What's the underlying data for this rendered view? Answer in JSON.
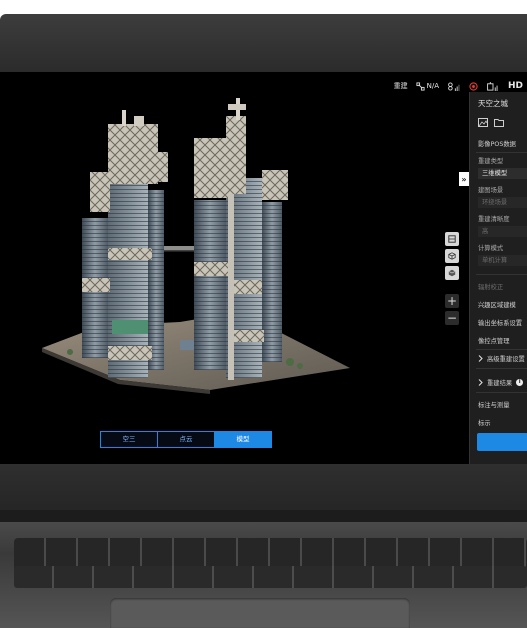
{
  "status_bar": {
    "rebuild_label": "重建",
    "gps_label": "N/A",
    "hd_label": "HD"
  },
  "view_toggle": {
    "tabs": [
      "空三",
      "点云",
      "模型"
    ],
    "active_index": 2
  },
  "panel": {
    "title": "天空之城",
    "pos_data_label": "影像POS数据",
    "rebuild_type_label": "重建类型",
    "rebuild_type_value": "三维模型",
    "scene_label": "建图场景",
    "scene_value": "环绕场景",
    "clarity_label": "重建清晰度",
    "clarity_value": "高",
    "compute_mode_label": "计算模式",
    "compute_mode_value": "单机计算",
    "radiometric_label": "辐射校正",
    "roi_label": "兴趣区域建模",
    "output_coords_label": "输出坐标系设置",
    "control_points_label": "像控点管理",
    "advanced_label": "高级重建设置",
    "result_label": "重建结果",
    "annotate_label": "标注与测量",
    "footer_label": "标示"
  },
  "toolbar": {
    "collapse_symbol": "»",
    "zoom_in_symbol": "+",
    "zoom_out_symbol": "−"
  },
  "colors": {
    "accent": "#1e88e5",
    "panel_bg": "#1f1f1f",
    "screen_bg": "#000000"
  }
}
